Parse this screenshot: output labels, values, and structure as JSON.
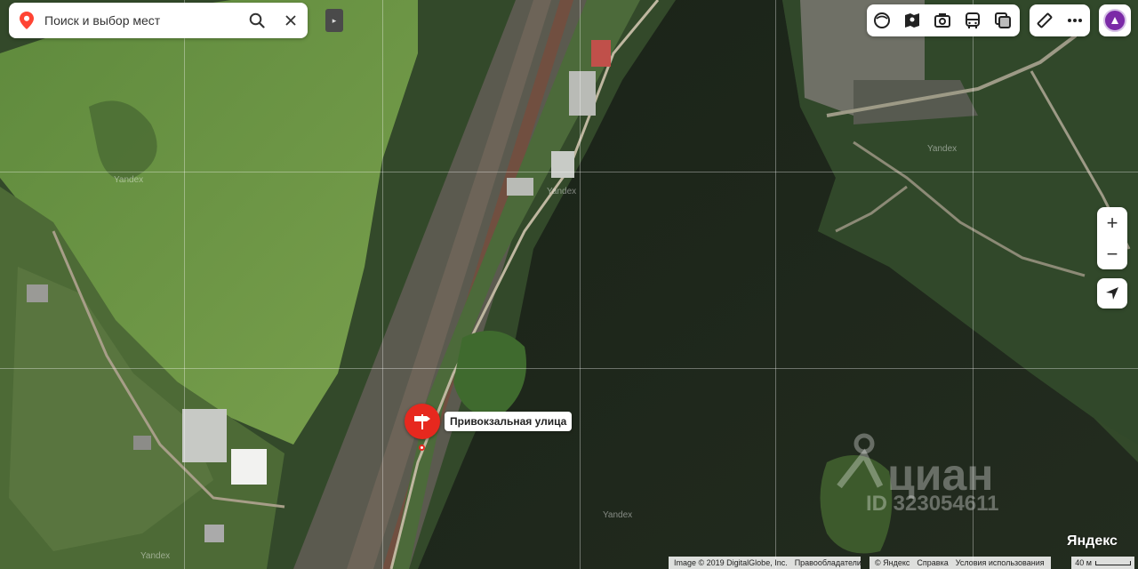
{
  "search": {
    "placeholder": "Поиск и выбор мест"
  },
  "toolbar": {
    "main_icons": [
      "layers-circle-icon",
      "map-book-icon",
      "panorama-icon",
      "transport-icon",
      "layers-icon"
    ],
    "extra_icons": [
      "ruler-icon",
      "more-icon"
    ]
  },
  "zoom": {
    "in_label": "+",
    "out_label": "−"
  },
  "marker": {
    "label": "Привокзальная улица",
    "color": "#e7281e"
  },
  "map_labels": {
    "tile_brand": "Yandex"
  },
  "watermark": {
    "brand": "циан",
    "id": "ID 323054611"
  },
  "footer": {
    "logo": "Яндекс",
    "image_credit": "Image © 2019 DigitalGlobe, Inc.",
    "rights_holders": "Правообладатели",
    "yandex_copyright": "© Яндекс",
    "help": "Справка",
    "terms": "Условия использования",
    "scale": "40 м"
  }
}
